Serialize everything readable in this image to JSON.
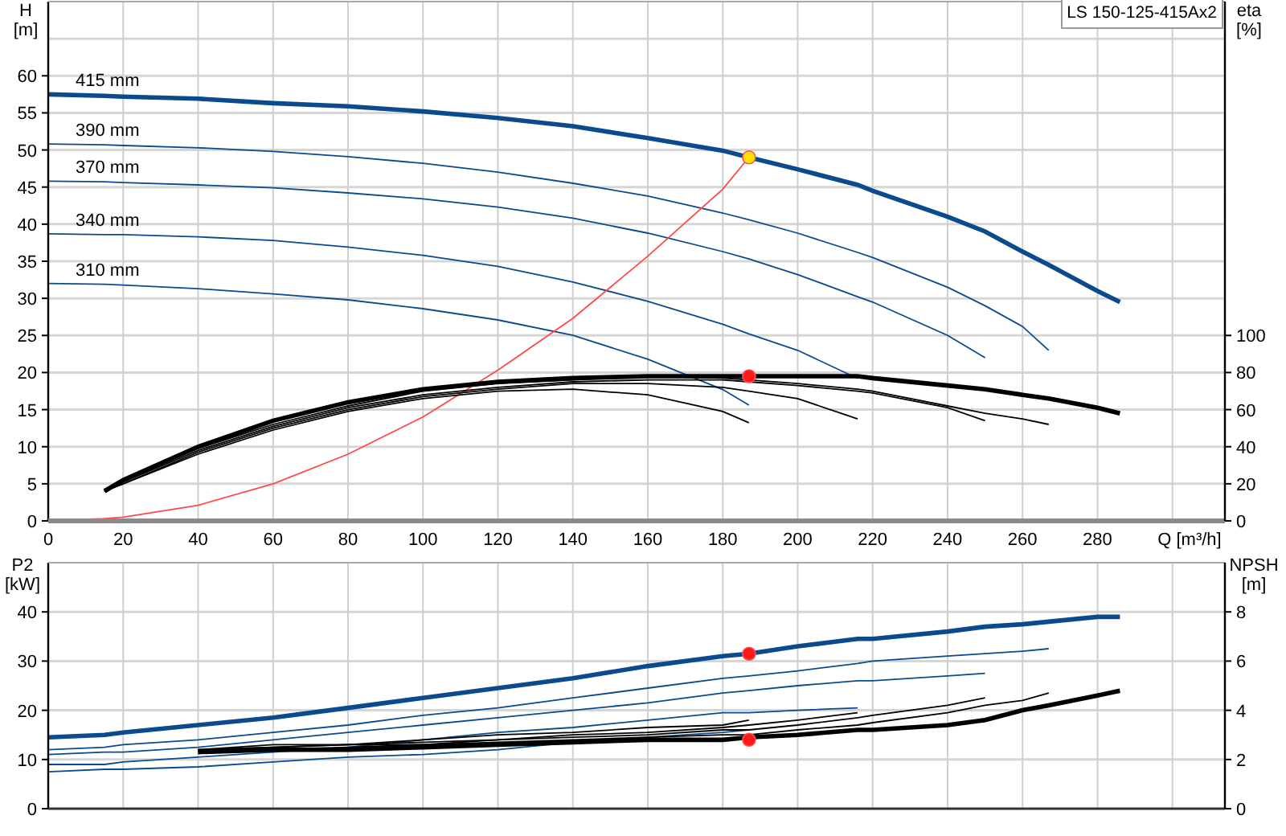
{
  "model_label": "LS 150-125-415Ax2",
  "head_chart": {
    "unit": "[m]",
    "series_styles": [
      {
        "selected": true
      },
      {
        "selected": false
      },
      {
        "selected": false
      },
      {
        "selected": false
      },
      {
        "selected": false
      },
      {
        "selected": false
      }
    ],
    "chart_data": {
      "type": "line",
      "xlabel": "Q [m³/h]",
      "ylabel": "H",
      "grid": true,
      "x": [
        0,
        15,
        20,
        40,
        60,
        80,
        100,
        120,
        140,
        160,
        180,
        187,
        200,
        216,
        220,
        240,
        250,
        260,
        267,
        280,
        286
      ],
      "xlim": [
        0,
        314
      ],
      "ylim": [
        0,
        70
      ],
      "xticks": [
        0,
        20,
        40,
        60,
        80,
        100,
        120,
        140,
        160,
        180,
        200,
        220,
        240,
        260,
        280
      ],
      "yticks": [
        0,
        5,
        10,
        15,
        20,
        25,
        30,
        35,
        40,
        45,
        50,
        55,
        60
      ],
      "series": [
        {
          "name": "415 mm",
          "color": "#0b4a8c",
          "values": [
            57.5,
            57.3,
            57.2,
            56.9,
            56.3,
            55.9,
            55.2,
            54.3,
            53.2,
            51.6,
            49.9,
            49,
            47.4,
            45.3,
            44.5,
            41,
            39,
            36.3,
            34.5,
            31,
            29.5
          ]
        },
        {
          "name": "390 mm",
          "color": "#0b4a8c",
          "values": [
            50.8,
            50.7,
            50.6,
            50.3,
            49.8,
            49.1,
            48.2,
            47,
            45.5,
            43.8,
            41.5,
            40.6,
            38.8,
            36.2,
            35.5,
            31.5,
            29,
            26.2,
            23,
            null,
            null
          ]
        },
        {
          "name": "370 mm",
          "color": "#0b4a8c",
          "values": [
            45.8,
            45.7,
            45.6,
            45.3,
            44.9,
            44.2,
            43.4,
            42.3,
            40.8,
            38.8,
            36.3,
            35.3,
            33.2,
            30.2,
            29.5,
            25,
            22,
            null,
            null,
            null,
            null
          ]
        },
        {
          "name": "340 mm",
          "color": "#0b4a8c",
          "values": [
            38.7,
            38.6,
            38.6,
            38.3,
            37.8,
            36.9,
            35.8,
            34.3,
            32.2,
            29.6,
            26.5,
            25.2,
            23,
            19.2,
            null,
            null,
            null,
            null,
            null,
            null,
            null
          ]
        },
        {
          "name": "310 mm",
          "color": "#0b4a8c",
          "values": [
            32,
            31.9,
            31.8,
            31.3,
            30.6,
            29.8,
            28.6,
            27.1,
            25,
            21.8,
            17.7,
            15.6,
            null,
            null,
            null,
            null,
            null,
            null,
            null,
            null,
            null
          ]
        },
        {
          "color": "#ff4a4a",
          "values": [
            0,
            0.3,
            0.5,
            2.1,
            5,
            9,
            14,
            20.3,
            27.3,
            35.7,
            44.7,
            49,
            null,
            null,
            null,
            null,
            null,
            null,
            null,
            null,
            null
          ]
        },
        {
          "color": "#ffe000",
          "marker": "circle",
          "values": [
            null,
            null,
            null,
            null,
            null,
            null,
            null,
            null,
            null,
            null,
            null,
            49,
            null,
            null,
            null,
            null,
            null,
            null,
            null,
            null,
            null
          ]
        }
      ]
    }
  },
  "efficiency_chart": {
    "unit": "[%]",
    "chart_data": {
      "type": "line",
      "ylabel": "eta",
      "x": [
        15,
        20,
        40,
        60,
        80,
        100,
        120,
        140,
        160,
        180,
        187,
        200,
        216,
        220,
        240,
        250,
        260,
        267,
        280,
        286
      ],
      "xlim": [
        0,
        314
      ],
      "ylim": [
        0,
        280
      ],
      "yticks": [
        0,
        20,
        40,
        60,
        80,
        100
      ],
      "series": [
        {
          "color": "#000000",
          "values": [
            16,
            22,
            40,
            54,
            64,
            71,
            75,
            77,
            78,
            78,
            78,
            78,
            78,
            77,
            73,
            71,
            68,
            66,
            61,
            58
          ]
        },
        {
          "color": "#000000",
          "values": [
            16,
            22,
            39,
            52,
            62,
            70,
            74,
            76,
            78,
            77,
            76,
            74,
            71,
            70,
            62,
            58,
            55,
            52,
            null,
            null
          ]
        },
        {
          "color": "#000000",
          "values": [
            16,
            21,
            38,
            51,
            61,
            68,
            72,
            75,
            76,
            76,
            75,
            73,
            70,
            69,
            61,
            54,
            null,
            null,
            null,
            null
          ]
        },
        {
          "color": "#000000",
          "values": [
            16,
            20,
            37,
            50,
            60,
            67,
            71,
            74,
            74,
            72,
            70,
            66,
            55,
            null,
            null,
            null,
            null,
            null,
            null,
            null
          ]
        },
        {
          "color": "#000000",
          "values": [
            16,
            20,
            36,
            49,
            59,
            66,
            70,
            71,
            68,
            59,
            53,
            null,
            null,
            null,
            null,
            null,
            null,
            null,
            null,
            null
          ]
        },
        {
          "color": "#ff1a1a",
          "marker": "circle",
          "values": [
            null,
            null,
            null,
            null,
            null,
            null,
            null,
            null,
            null,
            null,
            78,
            null,
            null,
            null,
            null,
            null,
            null,
            null,
            null,
            null
          ]
        }
      ]
    }
  },
  "power_chart": {
    "unit": "[kW]",
    "chart_data": {
      "type": "line",
      "ylabel": "P2",
      "grid": true,
      "x": [
        0,
        15,
        20,
        40,
        60,
        80,
        100,
        120,
        140,
        160,
        180,
        187,
        200,
        216,
        220,
        240,
        250,
        260,
        267,
        280,
        286
      ],
      "xlim": [
        0,
        314
      ],
      "ylim": [
        0,
        50
      ],
      "yticks": [
        0,
        10,
        20,
        30,
        40
      ],
      "series": [
        {
          "color": "#0b4a8c",
          "values": [
            14.5,
            15,
            15.5,
            17,
            18.5,
            20.5,
            22.5,
            24.5,
            26.5,
            29,
            31,
            31.5,
            33,
            34.5,
            34.5,
            36,
            37,
            37.5,
            38,
            39,
            39
          ]
        },
        {
          "color": "#0b4a8c",
          "values": [
            12,
            12.5,
            13,
            14,
            15.5,
            17,
            19,
            20.5,
            22.5,
            24.5,
            26.5,
            27,
            28,
            29.5,
            30,
            31,
            31.5,
            32,
            32.5,
            null,
            null
          ]
        },
        {
          "color": "#0b4a8c",
          "values": [
            11,
            11.5,
            11.5,
            12.5,
            14,
            15.5,
            17,
            18.5,
            20,
            21.5,
            23.5,
            24,
            25,
            26,
            26,
            27,
            27.5,
            null,
            null,
            null,
            null
          ]
        },
        {
          "color": "#0b4a8c",
          "values": [
            9,
            9,
            9.5,
            10.5,
            11.5,
            12.5,
            14,
            15.5,
            16.5,
            18,
            19.5,
            19.5,
            20,
            20.5,
            null,
            null,
            null,
            null,
            null,
            null,
            null
          ]
        },
        {
          "color": "#0b4a8c",
          "values": [
            7.5,
            8,
            8,
            8.5,
            9.5,
            10.5,
            11,
            12,
            13.5,
            14.5,
            15.5,
            16,
            null,
            null,
            null,
            null,
            null,
            null,
            null,
            null,
            null
          ]
        },
        {
          "color": "#ff1a1a",
          "marker": "circle",
          "values": [
            null,
            null,
            null,
            null,
            null,
            null,
            null,
            null,
            null,
            null,
            null,
            31.5,
            null,
            null,
            null,
            null,
            null,
            null,
            null,
            null,
            null
          ]
        }
      ]
    }
  },
  "npsh_chart": {
    "unit": "[m]",
    "chart_data": {
      "type": "line",
      "ylabel": "NPSH",
      "x": [
        40,
        60,
        80,
        100,
        120,
        140,
        160,
        180,
        187,
        200,
        216,
        220,
        240,
        250,
        260,
        267,
        280,
        286
      ],
      "xlim": [
        0,
        314
      ],
      "ylim": [
        0,
        10
      ],
      "yticks": [
        0,
        2,
        4,
        6,
        8
      ],
      "series": [
        {
          "color": "#000000",
          "values": [
            2.3,
            2.4,
            2.4,
            2.5,
            2.6,
            2.7,
            2.8,
            2.8,
            2.9,
            3,
            3.2,
            3.2,
            3.4,
            3.6,
            4,
            4.2,
            4.6,
            4.8
          ]
        },
        {
          "color": "#000000",
          "values": [
            2.3,
            2.4,
            2.5,
            2.6,
            2.7,
            2.8,
            2.9,
            3,
            3,
            3.2,
            3.4,
            3.5,
            3.9,
            4.2,
            4.4,
            4.7,
            null,
            null
          ]
        },
        {
          "color": "#000000",
          "values": [
            2.4,
            2.5,
            2.6,
            2.6,
            2.8,
            2.9,
            3,
            3.2,
            3.2,
            3.4,
            3.7,
            3.8,
            4.2,
            4.5,
            null,
            null,
            null,
            null
          ]
        },
        {
          "color": "#000000",
          "values": [
            2.4,
            2.5,
            2.6,
            2.7,
            2.8,
            3,
            3.1,
            3.3,
            3.4,
            3.6,
            3.9,
            null,
            null,
            null,
            null,
            null,
            null,
            null
          ]
        },
        {
          "color": "#000000",
          "values": [
            2.4,
            2.6,
            2.6,
            2.8,
            3,
            3.1,
            3.3,
            3.4,
            3.6,
            null,
            null,
            null,
            null,
            null,
            null,
            null,
            null,
            null
          ]
        },
        {
          "color": "#ff1a1a",
          "marker": "circle",
          "values": [
            null,
            null,
            null,
            null,
            null,
            null,
            null,
            null,
            2.8,
            null,
            null,
            null,
            null,
            null,
            null,
            null,
            null,
            null
          ]
        }
      ]
    }
  }
}
